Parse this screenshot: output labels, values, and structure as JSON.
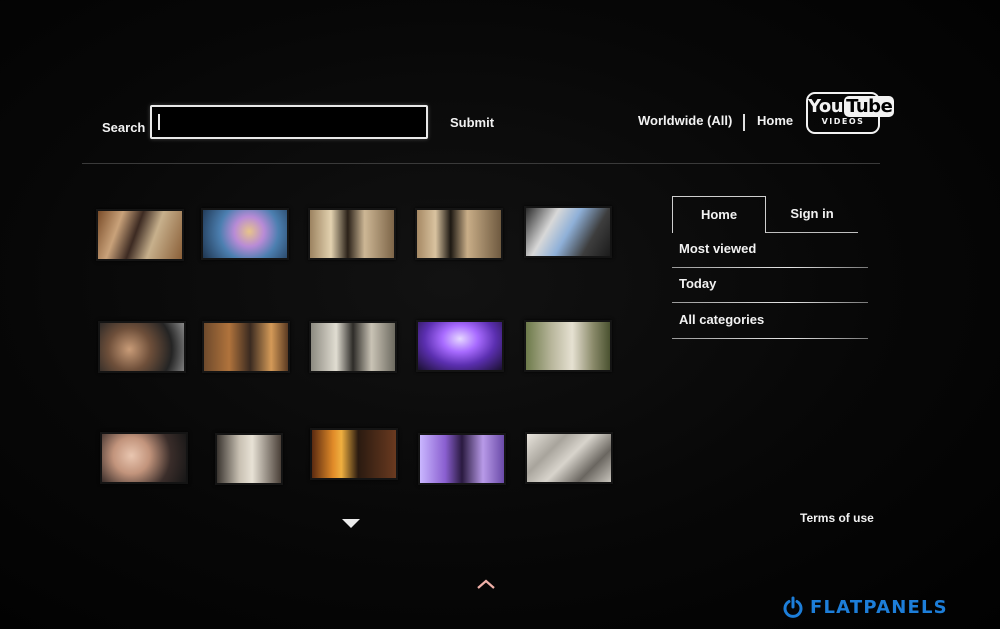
{
  "search": {
    "label": "Search",
    "value": "",
    "submit_label": "Submit"
  },
  "header": {
    "region_label": "Worldwide (All)",
    "home_label": "Home"
  },
  "logo": {
    "you": "You",
    "tube": "Tube",
    "sub": "VIDEOS"
  },
  "tabs": [
    {
      "label": "Home",
      "selected": true
    },
    {
      "label": "Sign in",
      "selected": false
    }
  ],
  "menu": {
    "items": [
      {
        "label": "Most viewed"
      },
      {
        "label": "Today"
      },
      {
        "label": "All categories"
      }
    ]
  },
  "footer": {
    "terms_label": "Terms of use"
  },
  "watermark": {
    "text": "FLATPANELS"
  },
  "video_grid": {
    "rows": 3,
    "columns": 5,
    "thumbnails": [
      "video-thumbnail",
      "video-thumbnail",
      "video-thumbnail",
      "video-thumbnail",
      "video-thumbnail",
      "video-thumbnail",
      "video-thumbnail",
      "video-thumbnail",
      "video-thumbnail",
      "video-thumbnail",
      "video-thumbnail",
      "video-thumbnail",
      "video-thumbnail",
      "video-thumbnail",
      "video-thumbnail"
    ]
  },
  "icons": {
    "scroll_down": "triangle-down-icon",
    "scroll_up": "chevron-up-icon",
    "watermark": "power-icon"
  },
  "colors": {
    "background": "#050505",
    "text": "#f2f2f2",
    "watermark": "#1d7ed9"
  }
}
